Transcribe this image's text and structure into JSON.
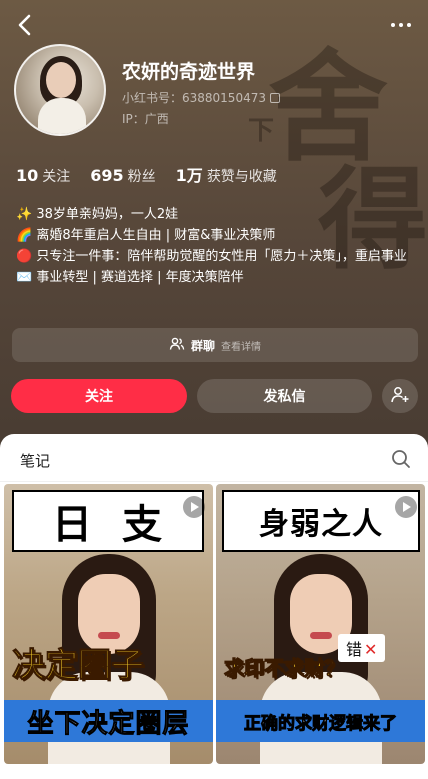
{
  "profile": {
    "nickname": "农妍的奇迹世界",
    "redbook_id": "小红书号：63880150473",
    "ip": "IP：广西"
  },
  "stats": [
    {
      "value": "10",
      "label": "关注"
    },
    {
      "value": "695",
      "label": "粉丝"
    },
    {
      "value": "1万",
      "label": "获赞与收藏"
    }
  ],
  "bio": [
    "✨ 38岁单亲妈妈，一人2娃",
    "🌈 离婚8年重启人生自由 | 财富&事业决策师",
    "🔴 只专注一件事：陪伴帮助觉醒的女性用「愿力＋决策」，重启事业",
    "✉️ 事业转型 | 赛道选择 | 年度决策陪伴"
  ],
  "group_chat": {
    "label": "群聊",
    "detail": "查看详情"
  },
  "actions": {
    "follow": "关注",
    "message": "发私信"
  },
  "tabs": {
    "notes": "笔记"
  },
  "background_calligraphy": [
    "舍",
    "得",
    "下"
  ],
  "cards": [
    {
      "title": "日支",
      "highlight": "决定圈子",
      "band": "坐下决定圈层"
    },
    {
      "title": "身弱之人",
      "tag": "错",
      "tag_mark": "✕",
      "highlight": "求印不求财？",
      "band": "正确的求财逻辑来了"
    }
  ],
  "colors": {
    "follow_button": "#ff2d46",
    "blue_band": "#2e78d8",
    "yellow_text": "#ffd92d"
  },
  "icons": [
    "back-arrow-icon",
    "more-dots-icon",
    "copy-icon",
    "group-chat-icon",
    "add-user-icon",
    "search-icon",
    "play-icon"
  ]
}
